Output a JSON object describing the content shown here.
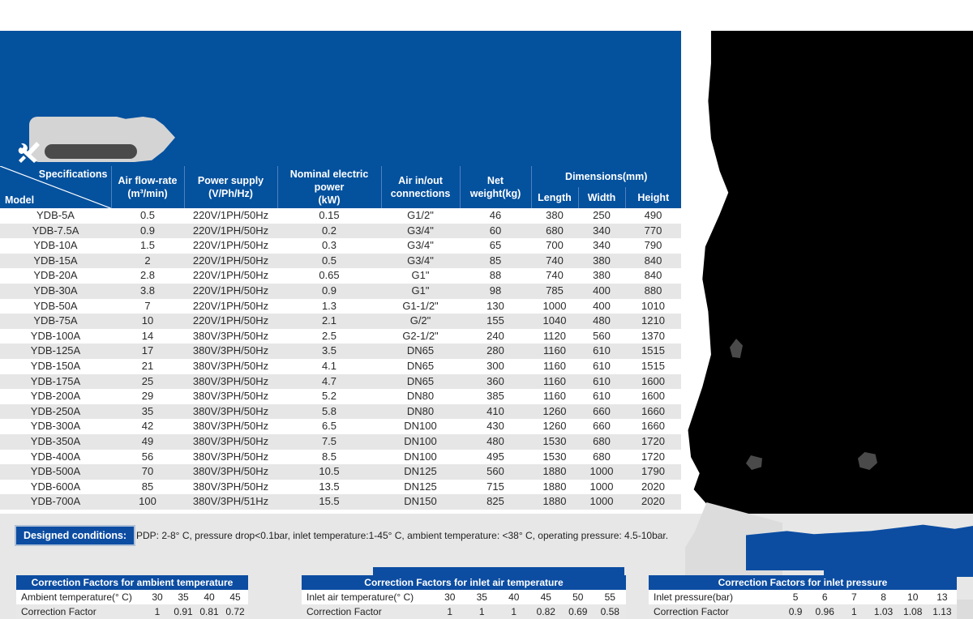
{
  "brand": {
    "accent_blue": "#04519E",
    "chip_blue": "#0C4DA2",
    "row_alt": "#E6E6E6"
  },
  "logo": {
    "icon": "tools-wrench-screwdriver-icon"
  },
  "spec_table": {
    "corner": {
      "specifications_label": "Specifications",
      "model_label": "Model"
    },
    "headers": [
      {
        "line1": "Air flow-rate",
        "line2": "(m³/min)"
      },
      {
        "line1": "Power supply",
        "line2": "(V/Ph/Hz)"
      },
      {
        "line1": "Nominal  electric power",
        "line2": "(kW)"
      },
      {
        "line1": "Air in/out",
        "line2": "connections"
      },
      {
        "line1": "Net weight(kg)",
        "line2": ""
      }
    ],
    "dimensions_group": "Dimensions(mm)",
    "dimensions_sub": [
      "Length",
      "Width",
      "Height"
    ],
    "rows": [
      [
        "YDB-5A",
        "0.5",
        "220V/1PH/50Hz",
        "0.15",
        "G1/2\"",
        "46",
        "380",
        "250",
        "490"
      ],
      [
        "YDB-7.5A",
        "0.9",
        "220V/1PH/50Hz",
        "0.2",
        "G3/4\"",
        "60",
        "680",
        "340",
        "770"
      ],
      [
        "YDB-10A",
        "1.5",
        "220V/1PH/50Hz",
        "0.3",
        "G3/4\"",
        "65",
        "700",
        "340",
        "790"
      ],
      [
        "YDB-15A",
        "2",
        "220V/1PH/50Hz",
        "0.5",
        "G3/4\"",
        "85",
        "740",
        "380",
        "840"
      ],
      [
        "YDB-20A",
        "2.8",
        "220V/1PH/50Hz",
        "0.65",
        "G1\"",
        "88",
        "740",
        "380",
        "840"
      ],
      [
        "YDB-30A",
        "3.8",
        "220V/1PH/50Hz",
        "0.9",
        "G1\"",
        "98",
        "785",
        "400",
        "880"
      ],
      [
        "YDB-50A",
        "7",
        "220V/1PH/50Hz",
        "1.3",
        "G1-1/2\"",
        "130",
        "1000",
        "400",
        "1010"
      ],
      [
        "YDB-75A",
        "10",
        "220V/1PH/50Hz",
        "2.1",
        "G/2\"",
        "155",
        "1040",
        "480",
        "1210"
      ],
      [
        "YDB-100A",
        "14",
        "380V/3PH/50Hz",
        "2.5",
        "G2-1/2\"",
        "240",
        "1120",
        "560",
        "1370"
      ],
      [
        "YDB-125A",
        "17",
        "380V/3PH/50Hz",
        "3.5",
        "DN65",
        "280",
        "1160",
        "610",
        "1515"
      ],
      [
        "YDB-150A",
        "21",
        "380V/3PH/50Hz",
        "4.1",
        "DN65",
        "300",
        "1160",
        "610",
        "1515"
      ],
      [
        "YDB-175A",
        "25",
        "380V/3PH/50Hz",
        "4.7",
        "DN65",
        "360",
        "1160",
        "610",
        "1600"
      ],
      [
        "YDB-200A",
        "29",
        "380V/3PH/50Hz",
        "5.2",
        "DN80",
        "385",
        "1160",
        "610",
        "1600"
      ],
      [
        "YDB-250A",
        "35",
        "380V/3PH/50Hz",
        "5.8",
        "DN80",
        "410",
        "1260",
        "660",
        "1660"
      ],
      [
        "YDB-300A",
        "42",
        "380V/3PH/50Hz",
        "6.5",
        "DN100",
        "430",
        "1260",
        "660",
        "1660"
      ],
      [
        "YDB-350A",
        "49",
        "380V/3PH/50Hz",
        "7.5",
        "DN100",
        "480",
        "1530",
        "680",
        "1720"
      ],
      [
        "YDB-400A",
        "56",
        "380V/3PH/50Hz",
        "8.5",
        "DN100",
        "495",
        "1530",
        "680",
        "1720"
      ],
      [
        "YDB-500A",
        "70",
        "380V/3PH/50Hz",
        "10.5",
        "DN125",
        "560",
        "1880",
        "1000",
        "1790"
      ],
      [
        "YDB-600A",
        "85",
        "380V/3PH/50Hz",
        "13.5",
        "DN125",
        "715",
        "1880",
        "1000",
        "2020"
      ],
      [
        "YDB-700A",
        "100",
        "380V/3PH/51Hz",
        "15.5",
        "DN150",
        "825",
        "1880",
        "1000",
        "2020"
      ]
    ]
  },
  "designed_conditions": {
    "chip_label": "Designed conditions:",
    "text": "PDP: 2-8° C, pressure drop<0.1bar, inlet temperature:1-45° C, ambient temperature: <38° C, operating pressure: 4.5-10bar."
  },
  "correction_factors": [
    {
      "title": "Correction Factors for ambient temperature",
      "row_label_1": "Ambient temperature(° C)",
      "row_label_2": "Correction Factor",
      "values_1": [
        "30",
        "35",
        "40",
        "45"
      ],
      "values_2": [
        "1",
        "0.91",
        "0.81",
        "0.72"
      ]
    },
    {
      "title": "Correction Factors for inlet air temperature",
      "row_label_1": "Inlet air temperature(° C)",
      "row_label_2": "Correction Factor",
      "values_1": [
        "30",
        "35",
        "40",
        "45",
        "50",
        "55"
      ],
      "values_2": [
        "1",
        "1",
        "1",
        "0.82",
        "0.69",
        "0.58"
      ]
    },
    {
      "title": "Correction Factors for inlet pressure",
      "row_label_1": "Inlet pressure(bar)",
      "row_label_2": "Correction Factor",
      "values_1": [
        "5",
        "6",
        "7",
        "8",
        "10",
        "13"
      ],
      "values_2": [
        "0.9",
        "0.96",
        "1",
        "1.03",
        "1.08",
        "1.13"
      ]
    }
  ],
  "product_image": {
    "alt": "redacted-product-silhouette"
  }
}
